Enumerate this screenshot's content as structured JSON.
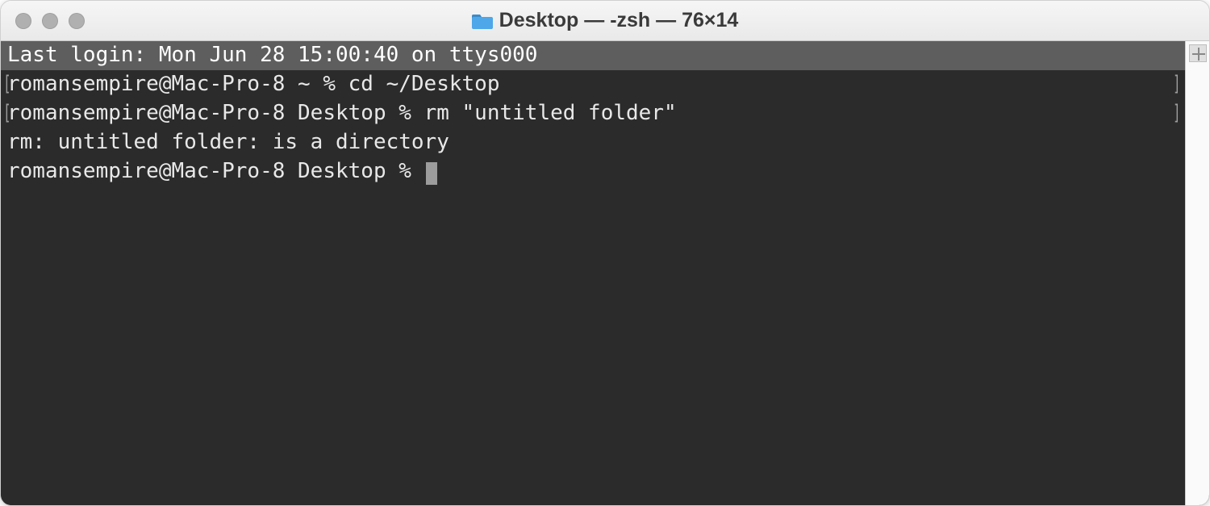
{
  "window": {
    "title": "Desktop — -zsh — 76×14"
  },
  "terminal": {
    "last_login": "Last login: Mon Jun 28 15:00:40 on ttys000",
    "lines": [
      {
        "prompt": "romansempire@Mac-Pro-8 ~ % ",
        "command": "cd ~/Desktop"
      },
      {
        "prompt": "romansempire@Mac-Pro-8 Desktop % ",
        "command": "rm \"untitled folder\""
      }
    ],
    "output": "rm: untitled folder: is a directory",
    "current_prompt": "romansempire@Mac-Pro-8 Desktop % "
  }
}
